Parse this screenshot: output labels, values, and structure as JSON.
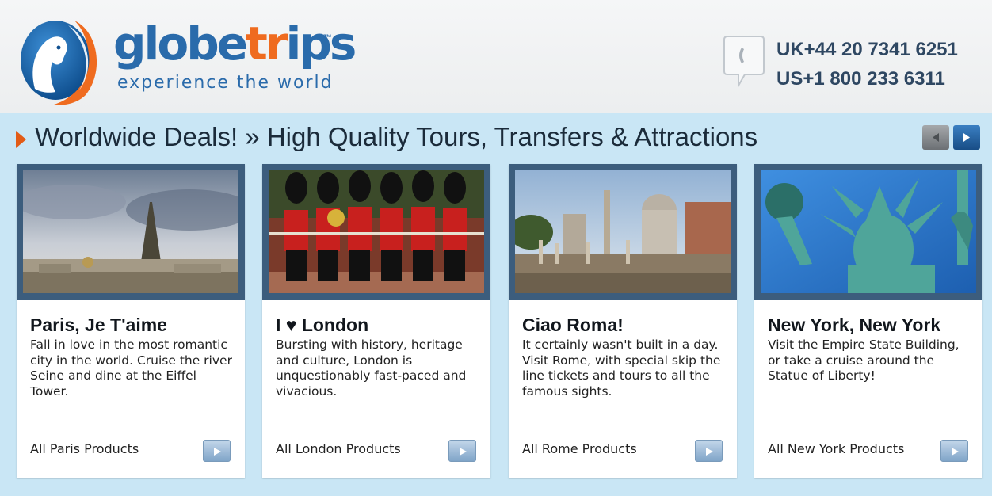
{
  "brand": {
    "name_a": "globe",
    "name_b": "tr",
    "name_c": "ips",
    "trademark": "™",
    "tagline": "experience the world"
  },
  "contact": {
    "uk_phone": "UK+44 20 7341 6251",
    "us_phone": "US+1 800 233 6311"
  },
  "deals": {
    "title": "Worldwide Deals! » High Quality Tours, Transfers & Attractions",
    "nav": {
      "prev_icon": "triangle-left-icon",
      "next_icon": "triangle-right-icon"
    }
  },
  "cards": [
    {
      "title": "Paris, Je T'aime",
      "description": "Fall in love in the most romantic city in the world. Cruise the river Seine and dine at the Eiffel Tower.",
      "link": "All Paris Products"
    },
    {
      "title": "I ♥ London",
      "description": "Bursting with history, heritage and culture, London is unquestionably fast-paced and vivacious.",
      "link": "All London Products"
    },
    {
      "title": "Ciao Roma!",
      "description": "It certainly wasn't built in a day. Visit Rome, with special skip the line tickets and tours to all the famous sights.",
      "link": "All Rome Products"
    },
    {
      "title": "New York, New York",
      "description": "Visit the Empire State Building, or take a cruise around the Statue of Liberty!",
      "link": "All New York Products"
    }
  ],
  "colors": {
    "accent_orange": "#e25b16",
    "brand_blue": "#2a6bab",
    "panel_bg": "#c9e6f5",
    "photo_frame": "#3c5d7d"
  }
}
